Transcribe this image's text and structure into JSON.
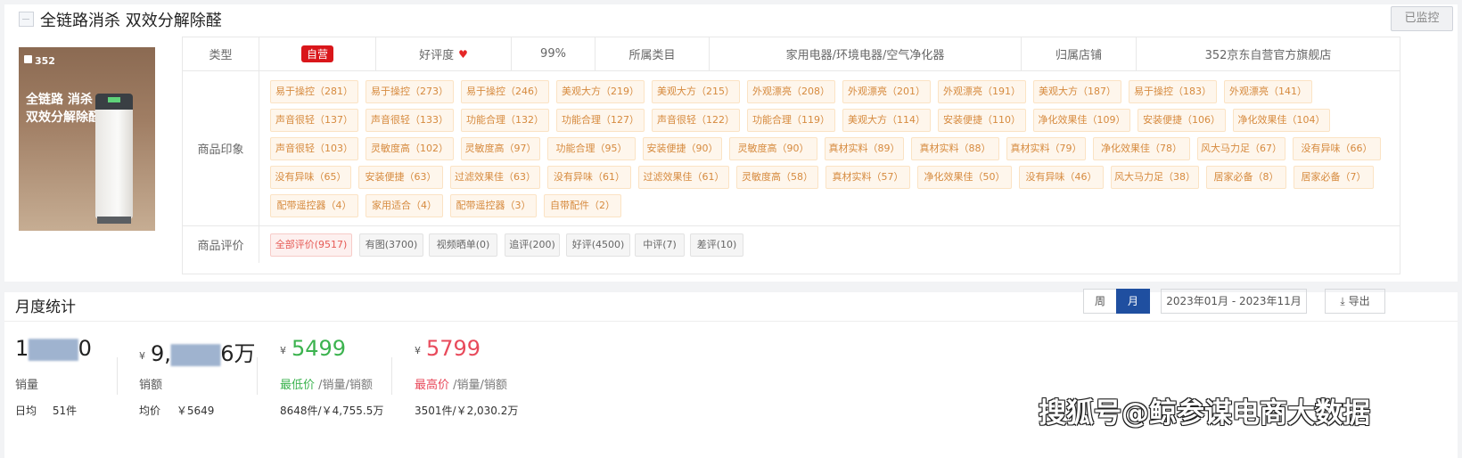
{
  "product": {
    "title": "全链路消杀 双效分解除醛",
    "monitor_label": "已监控",
    "image": {
      "brand": "352",
      "line1": "全链路 消杀",
      "line2": "双效分解除醛"
    }
  },
  "info_row": {
    "type_label": "类型",
    "type_badge": "自营",
    "rating_label": "好评度",
    "rating_value": "99%",
    "category_label": "所属类目",
    "category_value": "家用电器/环境电器/空气净化器",
    "store_label": "归属店铺",
    "store_value": "352京东自营官方旗舰店"
  },
  "impressions": {
    "label": "商品印象",
    "tags": [
      "易于操控（281）",
      "易于操控（273）",
      "易于操控（246）",
      "美观大方（219）",
      "美观大方（215）",
      "外观漂亮（208）",
      "外观漂亮（201）",
      "外观漂亮（191）",
      "美观大方（187）",
      "易于操控（183）",
      "外观漂亮（141）",
      "声音很轻（137）",
      "声音很轻（133）",
      "功能合理（132）",
      "功能合理（127）",
      "声音很轻（122）",
      "功能合理（119）",
      "美观大方（114）",
      "安装便捷（110）",
      "净化效果佳（109）",
      "安装便捷（106）",
      "净化效果佳（104）",
      "声音很轻（103）",
      "灵敏度高（102）",
      "灵敏度高（97）",
      "功能合理（95）",
      "安装便捷（90）",
      "灵敏度高（90）",
      "真材实料（89）",
      "真材实料（88）",
      "真材实料（79）",
      "净化效果佳（78）",
      "风大马力足（67）",
      "没有异味（66）",
      "没有异味（65）",
      "安装便捷（63）",
      "过滤效果佳（63）",
      "没有异味（61）",
      "过滤效果佳（61）",
      "灵敏度高（58）",
      "真材实料（57）",
      "净化效果佳（50）",
      "没有异味（46）",
      "风大马力足（38）",
      "居家必备（8）",
      "居家必备（7）",
      "配带遥控器（4）",
      "家用适合（4）",
      "配带遥控器（3）",
      "自带配件（2）"
    ]
  },
  "reviews": {
    "label": "商品评价",
    "filters": [
      "全部评价(9517)",
      "有图(3700)",
      "视频晒单(0)",
      "追评(200)",
      "好评(4500)",
      "中评(7)",
      "差评(10)"
    ]
  },
  "monthly": {
    "title": "月度统计",
    "week_label": "周",
    "month_label": "月",
    "date_range": "2023年01月 - 2023年11月",
    "export_label": "导出",
    "sales_value_visible_start": "1",
    "sales_value_visible_end": "0",
    "sales_label": "销量",
    "daily_label": "日均",
    "daily_value": "51件",
    "currency": "¥",
    "revenue_value_start": "9,",
    "revenue_value_end": "6万",
    "revenue_label": "销额",
    "avg_label": "均价",
    "avg_value": "￥5649",
    "min_price": "5499",
    "min_label": "最低价",
    "min_suffix": "/销量/销额",
    "min_detail": "8648件/￥4,755.5万",
    "max_price": "5799",
    "max_label": "最高价",
    "max_suffix": "/销量/销额",
    "max_detail": "3501件/￥2,030.2万"
  },
  "watermark": "搜狐号@鲸参谋电商大数据"
}
